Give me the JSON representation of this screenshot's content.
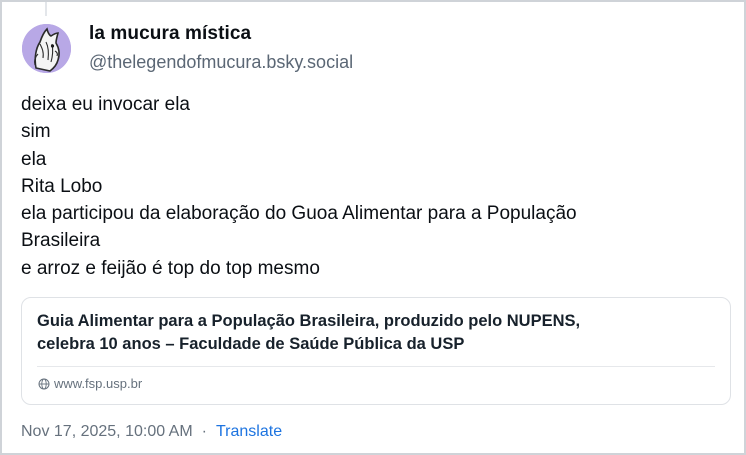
{
  "post": {
    "author": {
      "display_name": "la mucura mística",
      "handle": "@thelegendofmucura.bsky.social",
      "avatar_icon": "possum-avatar-icon"
    },
    "text_lines": [
      "deixa eu invocar ela",
      "sim",
      "ela",
      "Rita Lobo",
      "ela participou da elaboração do Guoa Alimentar para a População",
      "Brasileira",
      "e arroz e feijão é top do top mesmo"
    ],
    "link_card": {
      "title_line1": "Guia Alimentar para a População Brasileira, produzido pelo NUPENS,",
      "title_line2": "celebra 10 anos – Faculdade de Saúde Pública da USP",
      "domain": "www.fsp.usp.br",
      "domain_icon": "globe-icon"
    },
    "timestamp": "Nov 17, 2025, 10:00 AM",
    "separator": "·",
    "translate_label": "Translate"
  },
  "colors": {
    "avatar_bg": "#b8a8e6",
    "link": "#1d74e0",
    "muted": "#66717d"
  }
}
